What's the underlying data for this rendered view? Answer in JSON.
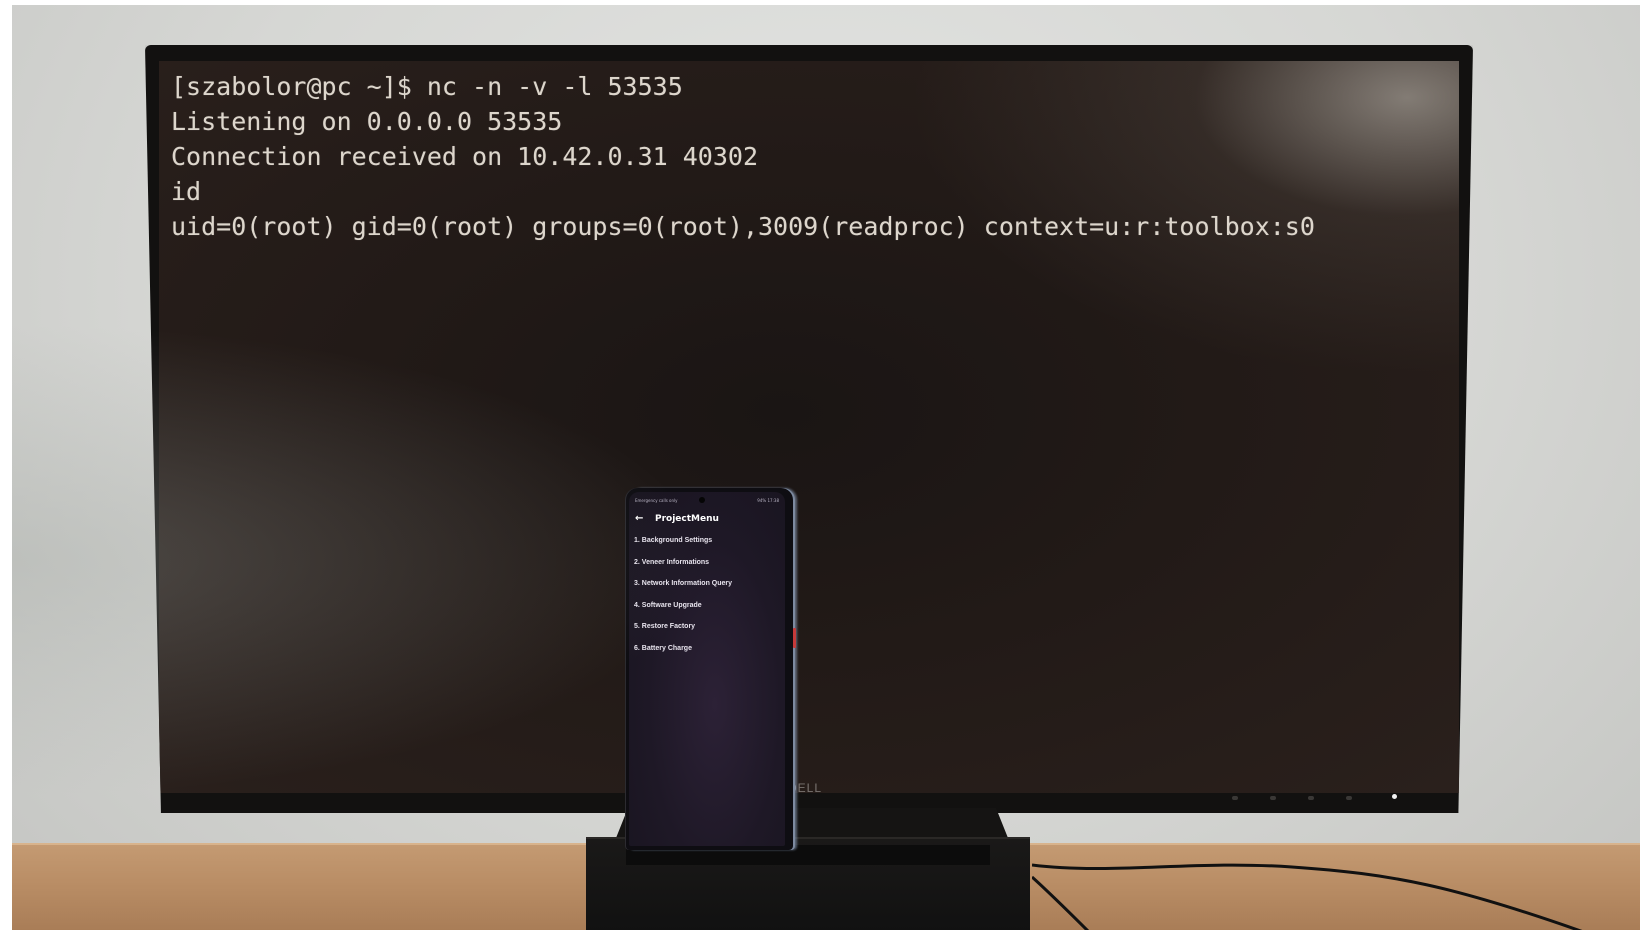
{
  "terminal": {
    "lines": [
      "[szabolor@pc ~]$ nc -n -v -l 53535",
      "Listening on 0.0.0.0 53535",
      "Connection received on 10.42.0.31 40302",
      "id",
      "uid=0(root) gid=0(root) groups=0(root),3009(readproc) context=u:r:toolbox:s0"
    ],
    "text_color": "#ddd6cc",
    "background_color": "#221a17"
  },
  "monitor": {
    "brand": "DELL"
  },
  "phone": {
    "status_left": "Emergency calls only",
    "status_right": "94% 17:38",
    "header": {
      "back_icon": "arrow-left-icon",
      "back_glyph": "←",
      "title": "ProjectMenu"
    },
    "menu_items": [
      "1. Background Settings",
      "2. Veneer Informations",
      "3. Network Information Query",
      "4. Software Upgrade",
      "5. Restore Factory",
      "6. Battery Charge"
    ],
    "accent_color": "#2c2136"
  }
}
